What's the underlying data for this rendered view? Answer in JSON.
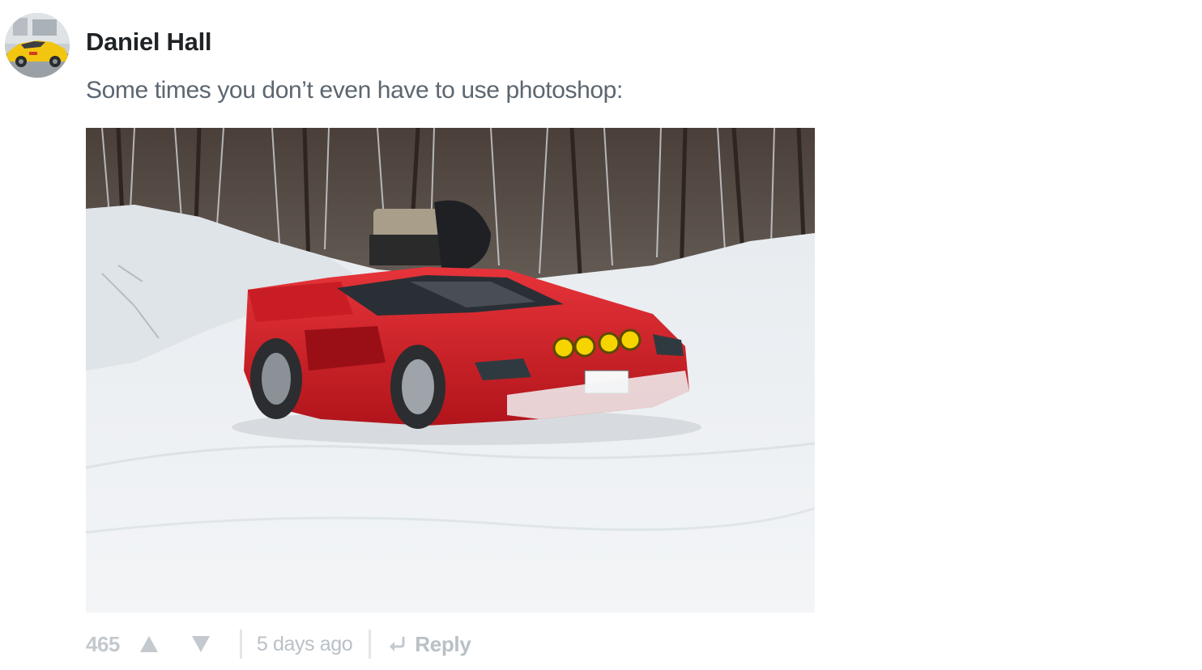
{
  "comment": {
    "author": "Daniel Hall",
    "text": "Some times you don’t even have to use photoshop:",
    "score": "465",
    "timestamp": "5 days ago",
    "reply_label": "Reply"
  },
  "icons": {
    "upvote": "triangle-up-icon",
    "downvote": "triangle-down-icon",
    "reply": "reply-arrow-icon"
  },
  "colors": {
    "author": "#1f2326",
    "body_text": "#5c6670",
    "muted": "#b9c0c6",
    "car_red": "#d8191f"
  }
}
